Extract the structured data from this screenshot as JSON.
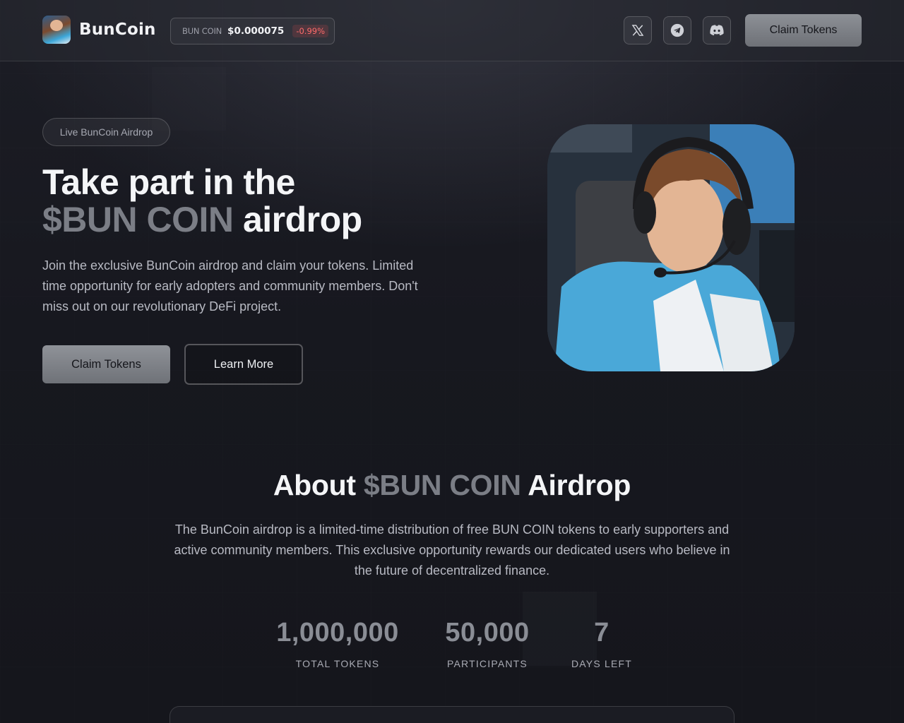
{
  "header": {
    "brand": "BunCoin",
    "ticker": {
      "label": "BUN COIN",
      "price": "$0.000075",
      "change": "-0.99%"
    },
    "social": [
      {
        "name": "x-icon"
      },
      {
        "name": "telegram-icon"
      },
      {
        "name": "discord-icon"
      }
    ],
    "claim_label": "Claim Tokens"
  },
  "hero": {
    "badge": "Live BunCoin Airdrop",
    "title_line1": "Take part in the",
    "title_accent": "$BUN COIN",
    "title_rest": "airdrop",
    "description": "Join the exclusive BunCoin airdrop and claim your tokens. Limited time opportunity for early adopters and community members. Don't miss out on our revolutionary DeFi project.",
    "primary_button": "Claim Tokens",
    "secondary_button": "Learn More"
  },
  "about": {
    "title_prefix": "About",
    "title_accent": "$BUN COIN",
    "title_suffix": "Airdrop",
    "description": "The BunCoin airdrop is a limited-time distribution of free BUN COIN tokens to early supporters and active community members. This exclusive opportunity rewards our dedicated users who believe in the future of decentralized finance.",
    "stats": [
      {
        "value": "1,000,000",
        "label": "TOTAL TOKENS"
      },
      {
        "value": "50,000",
        "label": "PARTICIPANTS"
      },
      {
        "value": "7",
        "label": "DAYS LEFT"
      }
    ]
  },
  "colors": {
    "background": "#17181f",
    "accent_gray": "#7b7e86",
    "negative": "#ff6b6b",
    "button_gray": "#8d9096"
  }
}
